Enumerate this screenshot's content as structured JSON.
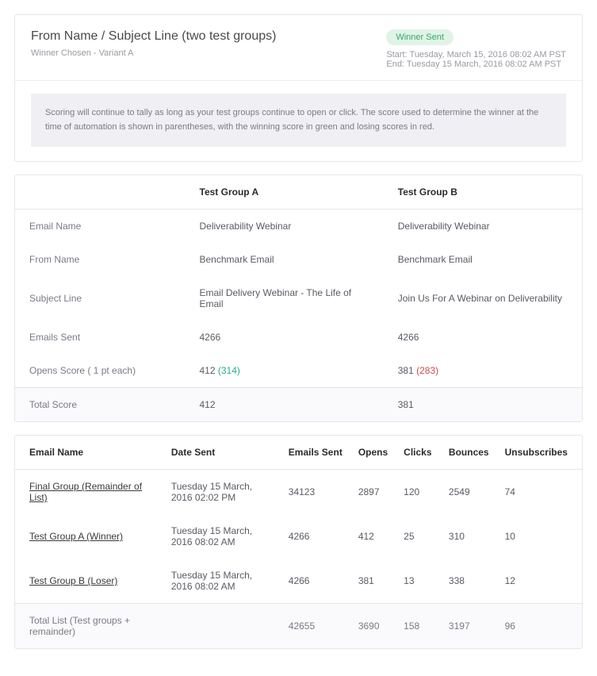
{
  "header": {
    "title": "From Name / Subject Line (two test groups)",
    "winner_chosen_label": "Winner Chosen - Variant A",
    "badge": "Winner Sent",
    "start_label": "Start: Tuesday, March 15, 2016 08:02 AM PST",
    "end_label": "End: Tuesday 15 March, 2016 08:02 AM PST",
    "info_text": "Scoring will continue to tally as long as your test groups continue to open or click. The score used to determine the winner at the time of automation is shown in parentheses, with the winning score in green and losing scores in red."
  },
  "compare": {
    "col_a": "Test Group A",
    "col_b": "Test Group B",
    "rows": {
      "email_name": {
        "label": "Email Name",
        "a": "Deliverability Webinar",
        "b": "Deliverability Webinar"
      },
      "from_name": {
        "label": "From Name",
        "a": "Benchmark Email",
        "b": "Benchmark Email"
      },
      "subject_line": {
        "label": "Subject Line",
        "a": "Email Delivery Webinar - The Life of Email",
        "b": "Join Us For A Webinar on Deliverability"
      },
      "emails_sent": {
        "label": "Emails Sent",
        "a": "4266",
        "b": "4266"
      },
      "opens_score": {
        "label": "Opens Score ( 1 pt each)",
        "a_main": "412",
        "a_paren": "(314)",
        "b_main": "381",
        "b_paren": "(283)"
      }
    },
    "total": {
      "label": "Total Score",
      "a": "412",
      "b": "381"
    }
  },
  "results": {
    "headers": {
      "email_name": "Email Name",
      "date_sent": "Date Sent",
      "emails_sent": "Emails Sent",
      "opens": "Opens",
      "clicks": "Clicks",
      "bounces": "Bounces",
      "unsubs": "Unsubscribes"
    },
    "rows": [
      {
        "name": "Final Group (Remainder of List)",
        "date": "Tuesday 15 March, 2016 02:02 PM",
        "sent": "34123",
        "opens": "2897",
        "clicks": "120",
        "bounces": "2549",
        "unsubs": "74"
      },
      {
        "name": "Test Group A (Winner)",
        "date": "Tuesday 15 March, 2016 08:02 AM",
        "sent": "4266",
        "opens": "412",
        "clicks": "25",
        "bounces": "310",
        "unsubs": "10"
      },
      {
        "name": "Test Group B (Loser)",
        "date": "Tuesday 15 March, 2016 08:02 AM",
        "sent": "4266",
        "opens": "381",
        "clicks": "13",
        "bounces": "338",
        "unsubs": "12"
      }
    ],
    "total": {
      "label": "Total List (Test groups + remainder)",
      "sent": "42655",
      "opens": "3690",
      "clicks": "158",
      "bounces": "3197",
      "unsubs": "96"
    }
  }
}
